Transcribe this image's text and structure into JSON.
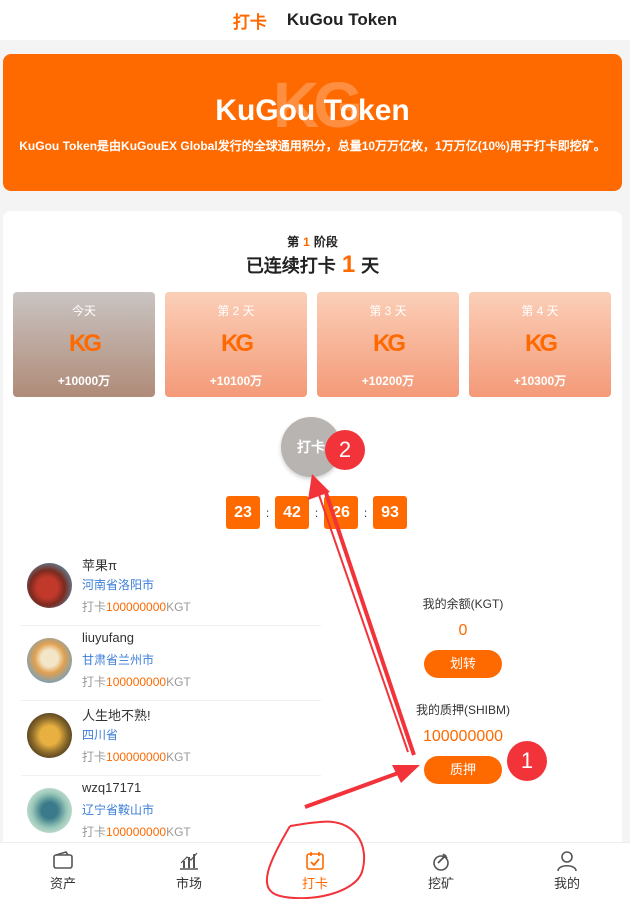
{
  "header": {
    "tab_active": "打卡",
    "tab_other": "KuGou Token"
  },
  "banner": {
    "logo_text": "KG",
    "title": "KuGou Token",
    "description": "KuGou Token是由KuGouEX Global发行的全球通用积分，总量10万万亿枚，1万万亿(10%)用于打卡即挖矿。"
  },
  "stage": {
    "prefix": "第",
    "number": "1",
    "suffix": "阶段"
  },
  "streak": {
    "prefix": "已连续打卡",
    "number": "1",
    "suffix": "天"
  },
  "days": [
    {
      "label": "今天",
      "logo": "KG",
      "amount": "+10000万"
    },
    {
      "label": "第 2 天",
      "logo": "KG",
      "amount": "+10100万"
    },
    {
      "label": "第 3 天",
      "logo": "KG",
      "amount": "+10200万"
    },
    {
      "label": "第 4 天",
      "logo": "KG",
      "amount": "+10300万"
    }
  ],
  "checkin_button": "打卡",
  "countdown": {
    "hours": "23",
    "minutes": "42",
    "seconds": "26",
    "centis": "93",
    "separator": ":"
  },
  "users": [
    {
      "name": "苹果π",
      "city": "河南省洛阳市",
      "check_prefix": "打卡",
      "amount": "100000000",
      "unit": "KGT"
    },
    {
      "name": "liuyufang",
      "city": "甘肃省兰州市",
      "check_prefix": "打卡",
      "amount": "100000000",
      "unit": "KGT"
    },
    {
      "name": "人生地不熟!",
      "city": "四川省",
      "check_prefix": "打卡",
      "amount": "100000000",
      "unit": "KGT"
    },
    {
      "name": "wzq17171",
      "city": "辽宁省鞍山市",
      "check_prefix": "打卡",
      "amount": "100000000",
      "unit": "KGT"
    }
  ],
  "balance": {
    "label": "我的余额(KGT)",
    "value": "0",
    "button": "划转"
  },
  "pledge": {
    "label": "我的质押(SHIBM)",
    "value": "100000000",
    "button": "质押"
  },
  "nav": [
    {
      "label": "资产",
      "icon": "wallet-icon"
    },
    {
      "label": "市场",
      "icon": "chart-icon"
    },
    {
      "label": "打卡",
      "icon": "calendar-check-icon"
    },
    {
      "label": "挖矿",
      "icon": "mining-icon"
    },
    {
      "label": "我的",
      "icon": "person-icon"
    }
  ],
  "annotations": {
    "badge_1": "1",
    "badge_2": "2",
    "color": "#f2333a"
  },
  "colors": {
    "accent": "#ff6a00",
    "city": "#3b7ed8"
  }
}
